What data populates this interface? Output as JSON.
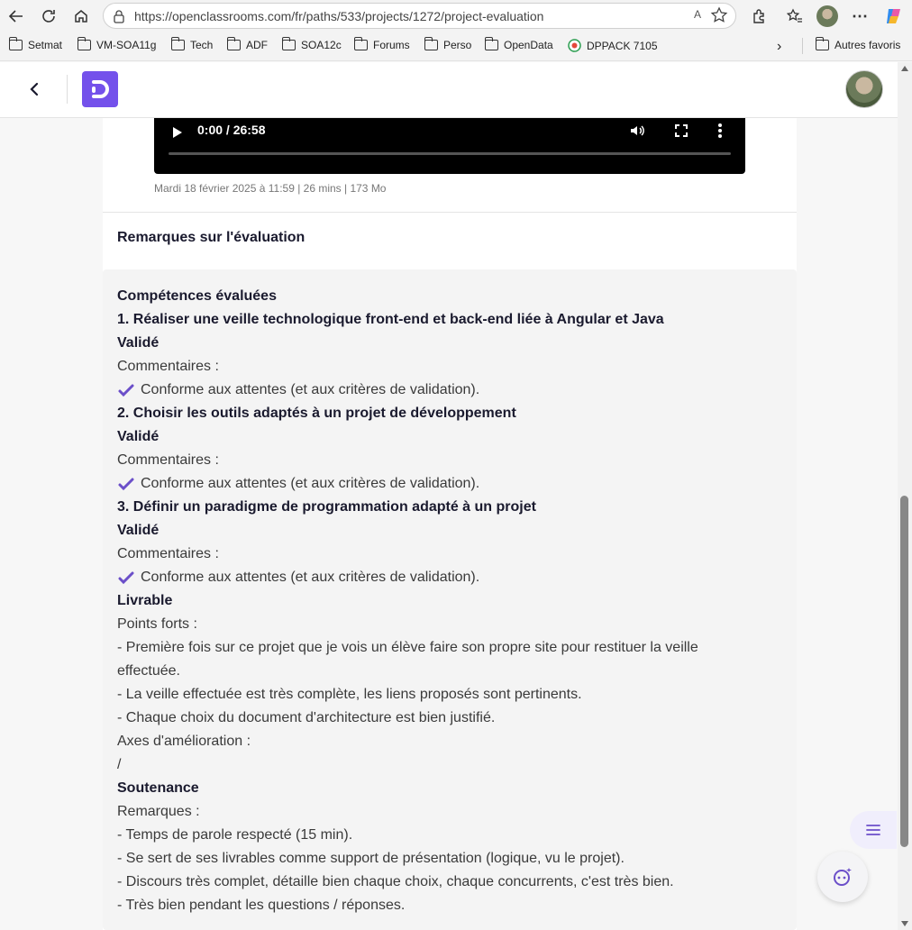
{
  "browser": {
    "url": "https://openclassrooms.com/fr/paths/533/projects/1272/project-evaluation",
    "read_aloud": "A",
    "bookmarks": [
      "Setmat",
      "VM-SOA11g",
      "Tech",
      "ADF",
      "SOA12c",
      "Forums",
      "Perso",
      "OpenData",
      "DPPACK 7105"
    ],
    "other_bookmarks": "Autres favoris"
  },
  "video": {
    "time": "0:00 / 26:58",
    "meta": "Mardi 18 février 2025 à 11:59 | 26 mins | 173 Mo"
  },
  "remarks_title": "Remarques sur l'évaluation",
  "evaluation_lines": [
    {
      "text": "Compétences évaluées",
      "bold": true
    },
    {
      "text": "1. Réaliser une veille technologique front-end et back-end liée à Angular et Java",
      "bold": true
    },
    {
      "text": "Validé",
      "bold": true
    },
    {
      "text": "Commentaires :"
    },
    {
      "text": "Conforme aux attentes (et aux critères de validation).",
      "check": true
    },
    {
      "text": "2. Choisir les outils adaptés à un projet de développement",
      "bold": true
    },
    {
      "text": "Validé",
      "bold": true
    },
    {
      "text": "Commentaires :"
    },
    {
      "text": "Conforme aux attentes (et aux critères de validation).",
      "check": true
    },
    {
      "text": "3. Définir un paradigme de programmation adapté à un projet",
      "bold": true
    },
    {
      "text": "Validé",
      "bold": true
    },
    {
      "text": "Commentaires :"
    },
    {
      "text": "Conforme aux attentes (et aux critères de validation).",
      "check": true
    },
    {
      "text": "Livrable",
      "bold": true
    },
    {
      "text": "Points forts :"
    },
    {
      "text": "- Première fois sur ce projet que je vois un élève faire son propre site pour restituer la veille"
    },
    {
      "text": "effectuée."
    },
    {
      "text": "- La veille effectuée est très complète, les liens proposés sont pertinents."
    },
    {
      "text": "- Chaque choix du document d'architecture est bien justifié."
    },
    {
      "text": "Axes d'amélioration :"
    },
    {
      "text": "/"
    },
    {
      "text": "Soutenance",
      "bold": true
    },
    {
      "text": "Remarques :"
    },
    {
      "text": "- Temps de parole respecté (15 min)."
    },
    {
      "text": "- Se sert de ses livrables comme support de présentation (logique, vu le projet)."
    },
    {
      "text": "- Discours très complet, détaille bien chaque choix, chaque concurrents, c'est très bien."
    },
    {
      "text": "- Très bien pendant les questions / réponses."
    }
  ],
  "colors": {
    "brand": "#7451eb",
    "check": "#6b4fc9"
  }
}
